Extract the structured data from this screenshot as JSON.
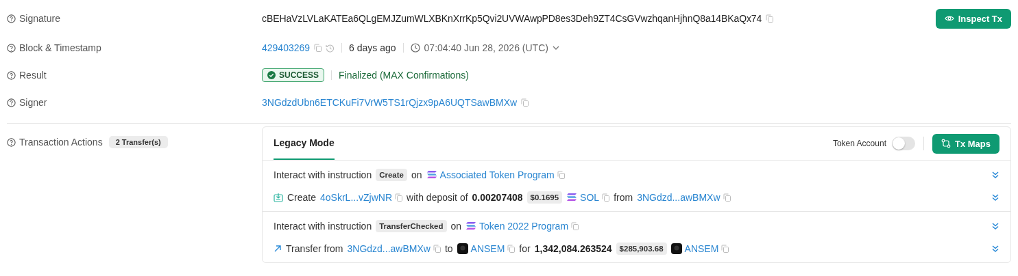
{
  "fields": [
    {
      "kind": "signature",
      "label": "Signature",
      "value": "cBEHaVzLVLaKATEa6QLgEMJZumWLXBKnXrrKp5Qvi2UVWAwpPD8es3Deh9ZT4CsGVwzhqanHjhnQ8a14BKaQx74",
      "button": "Inspect Tx"
    },
    {
      "kind": "block",
      "label": "Block & Timestamp",
      "block": "429403269",
      "age": "6 days ago",
      "time": "07:04:40 Jun 28, 2026 (UTC)"
    },
    {
      "kind": "result",
      "label": "Result",
      "status": "SUCCESS",
      "detail": "Finalized (MAX Confirmations)"
    },
    {
      "kind": "signer",
      "label": "Signer",
      "value": "3NGdzdUbn6ETCKuFi7VrW5TS1rQjzx9pA6UQTSawBMXw"
    }
  ],
  "actions": {
    "label": "Transaction Actions",
    "count": "2 Transfer(s)",
    "tabs": [
      {
        "label": "Legacy Mode",
        "selected": true
      }
    ],
    "toggle": {
      "label": "Token Account",
      "on": false
    },
    "button": "Tx Maps",
    "instructions": [
      {
        "lines": [
          [
            {
              "kind": "text",
              "text": "Interact with instruction"
            },
            {
              "kind": "tag",
              "text": "Create"
            },
            {
              "kind": "text",
              "text": "on"
            },
            {
              "kind": "program",
              "text": "Associated Token Program"
            }
          ],
          [
            {
              "kind": "create",
              "text": "Create"
            },
            {
              "kind": "address",
              "text": "4oSkrL...vZjwNR"
            },
            {
              "kind": "text",
              "text": "with deposit of"
            },
            {
              "kind": "amount",
              "text": "0.00207408"
            },
            {
              "kind": "tag",
              "text": "$0.1695"
            },
            {
              "kind": "program",
              "text": "SOL"
            },
            {
              "kind": "text",
              "text": "from"
            },
            {
              "kind": "address",
              "text": "3NGdzd...awBMXw"
            }
          ]
        ]
      },
      {
        "lines": [
          [
            {
              "kind": "text",
              "text": "Interact with instruction"
            },
            {
              "kind": "tag",
              "text": "TransferChecked"
            },
            {
              "kind": "text",
              "text": "on"
            },
            {
              "kind": "program",
              "text": "Token 2022 Program"
            }
          ],
          [
            {
              "kind": "transfer",
              "text": "Transfer from"
            },
            {
              "kind": "address",
              "text": "3NGdzd...awBMXw"
            },
            {
              "kind": "text",
              "text": "to"
            },
            {
              "kind": "token",
              "text": "ANSEM"
            },
            {
              "kind": "text",
              "text": "for"
            },
            {
              "kind": "amount",
              "text": "1,342,084.263524"
            },
            {
              "kind": "tag",
              "text": "$285,903.68"
            },
            {
              "kind": "token",
              "text": "ANSEM"
            }
          ]
        ]
      }
    ]
  }
}
